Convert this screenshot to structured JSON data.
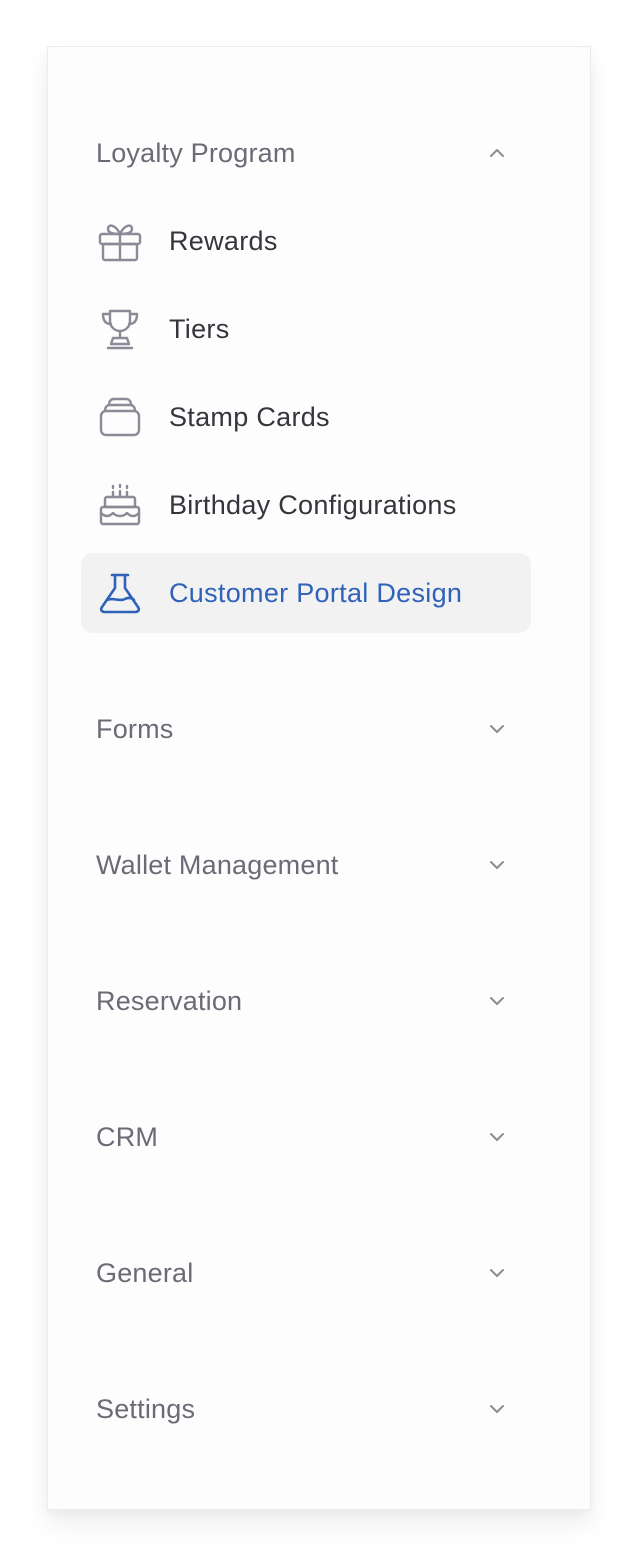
{
  "colors": {
    "group_title": "#6b6b76",
    "item_text": "#35353d",
    "active_text": "#2f62b8",
    "active_bg": "#f2f2f3",
    "icon_gray": "#8a8b97"
  },
  "loyalty": {
    "title": "Loyalty Program",
    "expanded": true,
    "chevron": "chevron-up-icon",
    "items": [
      {
        "label": "Rewards",
        "icon": "gift-icon"
      },
      {
        "label": "Tiers",
        "icon": "trophy-icon"
      },
      {
        "label": "Stamp Cards",
        "icon": "stamp-card-icon"
      },
      {
        "label": "Birthday Configurations",
        "icon": "birthday-cake-icon"
      },
      {
        "label": "Customer Portal Design",
        "icon": "flask-icon",
        "active": true
      }
    ]
  },
  "groups": [
    {
      "title": "Forms",
      "chevron": "chevron-down-icon"
    },
    {
      "title": "Wallet Management",
      "chevron": "chevron-down-icon"
    },
    {
      "title": "Reservation",
      "chevron": "chevron-down-icon"
    },
    {
      "title": "CRM",
      "chevron": "chevron-down-icon"
    },
    {
      "title": "General",
      "chevron": "chevron-down-icon"
    },
    {
      "title": "Settings",
      "chevron": "chevron-down-icon"
    }
  ]
}
